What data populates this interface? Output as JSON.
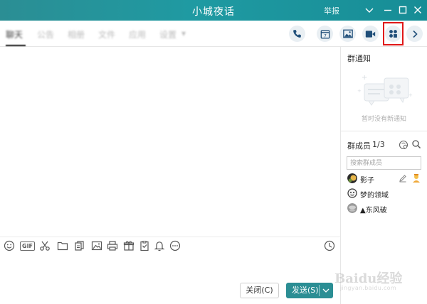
{
  "window": {
    "title": "小城夜话",
    "report_label": "举报"
  },
  "tabs": [
    {
      "label": "聊天",
      "active": true
    },
    {
      "label": "公告",
      "active": false
    },
    {
      "label": "相册",
      "active": false
    },
    {
      "label": "文件",
      "active": false
    },
    {
      "label": "应用",
      "active": false
    },
    {
      "label": "设置",
      "active": false
    }
  ],
  "toolbar_icons": [
    "phone-icon",
    "calendar-icon",
    "image-icon",
    "video-icon",
    "apps-icon",
    "chevron-right-icon"
  ],
  "calendar_day": "7",
  "input_toolbar": {
    "gif_label": "GIF",
    "icons": [
      "emoji-icon",
      "gif-icon",
      "scissors-icon",
      "folder-icon",
      "files-icon",
      "picture-icon",
      "printer-icon",
      "gift-icon",
      "clipboard-icon",
      "bell-icon",
      "more-icon",
      "clock-icon"
    ]
  },
  "actions": {
    "close_label": "关闭(C)",
    "send_label": "发送(S)"
  },
  "notice": {
    "title": "群通知",
    "empty_text": "暂时没有新通知"
  },
  "members": {
    "title": "群成员",
    "count": "1/3",
    "search_placeholder": "搜索群成员",
    "list": [
      {
        "name": "影子"
      },
      {
        "name": "梦的领域"
      },
      {
        "name": "▲东风破"
      }
    ]
  },
  "watermark": {
    "text": "Baidu经验",
    "sub": "jingyan.baidu.com"
  },
  "colors": {
    "brand": "#2b8e94",
    "highlight": "#e01818"
  }
}
